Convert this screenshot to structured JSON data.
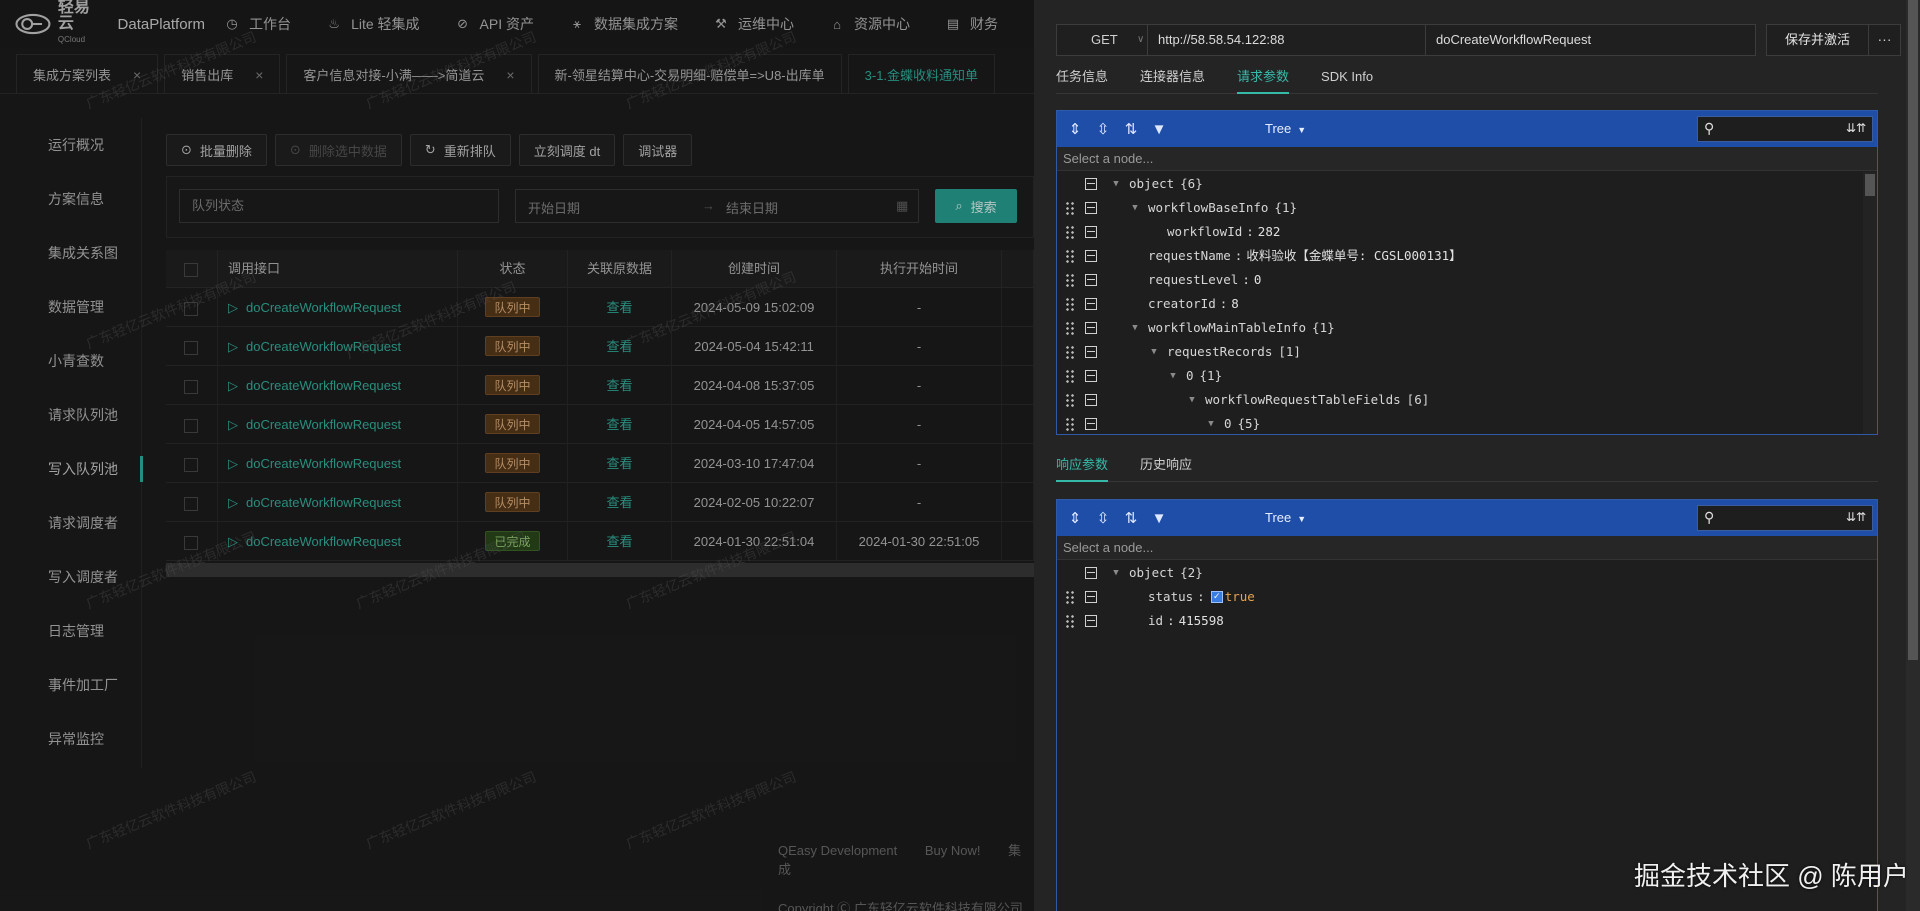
{
  "app": {
    "logo_text": "轻易云",
    "logo_sub": "QCloud",
    "brand": "DataPlatform",
    "nav": [
      {
        "label": "工作台",
        "icon": "clock-icon"
      },
      {
        "label": "Lite 轻集成",
        "icon": "bell-icon"
      },
      {
        "label": "API 资产",
        "icon": "compass-icon"
      },
      {
        "label": "数据集成方案",
        "icon": "network-icon"
      },
      {
        "label": "运维中心",
        "icon": "tools-icon"
      },
      {
        "label": "资源中心",
        "icon": "cluster-icon"
      },
      {
        "label": "财务",
        "icon": "ledger-icon"
      }
    ]
  },
  "tabs": [
    {
      "label": "集成方案列表"
    },
    {
      "label": "销售出库"
    },
    {
      "label": "客户信息对接-小满——>简道云"
    },
    {
      "label": "新-领星结算中心-交易明细-赔偿单=>U8-出库单"
    },
    {
      "label": "3-1.金蝶收料通知单",
      "active": true
    }
  ],
  "sidemenu": [
    "运行概况",
    "方案信息",
    "集成关系图",
    "数据管理",
    "小青查数",
    "请求队列池",
    "写入队列池",
    "请求调度者",
    "写入调度者",
    "日志管理",
    "事件加工厂",
    "异常监控"
  ],
  "sidemenu_active": "写入队列池",
  "toolbar": {
    "batch_delete": "批量删除",
    "delete_selected": "删除选中数据",
    "requeue": "重新排队",
    "schedule_now": "立刻调度 dt",
    "debugger": "调试器"
  },
  "filter": {
    "queue_status_placeholder": "队列状态",
    "start_date": "开始日期",
    "end_date": "结束日期",
    "search": "搜索"
  },
  "table": {
    "headers": [
      "调用接口",
      "状态",
      "关联原数据",
      "创建时间",
      "执行开始时间"
    ],
    "rows": [
      {
        "api": "doCreateWorkflowRequest",
        "status": "队列中",
        "status_type": "queue",
        "view": "查看",
        "created": "2024-05-09 15:02:09",
        "started": "-"
      },
      {
        "api": "doCreateWorkflowRequest",
        "status": "队列中",
        "status_type": "queue",
        "view": "查看",
        "created": "2024-05-04 15:42:11",
        "started": "-"
      },
      {
        "api": "doCreateWorkflowRequest",
        "status": "队列中",
        "status_type": "queue",
        "view": "查看",
        "created": "2024-04-08 15:37:05",
        "started": "-"
      },
      {
        "api": "doCreateWorkflowRequest",
        "status": "队列中",
        "status_type": "queue",
        "view": "查看",
        "created": "2024-04-05 14:57:05",
        "started": "-"
      },
      {
        "api": "doCreateWorkflowRequest",
        "status": "队列中",
        "status_type": "queue",
        "view": "查看",
        "created": "2024-03-10 17:47:04",
        "started": "-"
      },
      {
        "api": "doCreateWorkflowRequest",
        "status": "队列中",
        "status_type": "queue",
        "view": "查看",
        "created": "2024-02-05 10:22:07",
        "started": "-"
      },
      {
        "api": "doCreateWorkflowRequest",
        "status": "已完成",
        "status_type": "done",
        "view": "查看",
        "created": "2024-01-30 22:51:04",
        "started": "2024-01-30 22:51:05"
      }
    ]
  },
  "footer": {
    "links": [
      "QEasy Development",
      "Buy Now!",
      "集成"
    ],
    "copyright": "Copyright Ⓒ 广东轻亿云软件科技有限公司"
  },
  "watermark": "广东轻亿云软件科技有限公司",
  "drawer": {
    "method": "GET",
    "url": "http://58.58.54.122:88",
    "api_name": "doCreateWorkflowRequest",
    "save_label": "保存并激活",
    "more_label": "···",
    "tabs": [
      {
        "label": "任务信息"
      },
      {
        "label": "连接器信息"
      },
      {
        "label": "请求参数",
        "active": true
      },
      {
        "label": "SDK Info"
      }
    ],
    "resp_tabs": [
      {
        "label": "响应参数",
        "active": true
      },
      {
        "label": "历史响应"
      }
    ],
    "editor_mode": "Tree",
    "node_placeholder": "Select a node...",
    "request_tree": [
      {
        "depth": 0,
        "drag": false,
        "expand": true,
        "key": "object",
        "meta": "{6}"
      },
      {
        "depth": 1,
        "drag": true,
        "expand": true,
        "key": "workflowBaseInfo",
        "meta": "{1}"
      },
      {
        "depth": 2,
        "drag": true,
        "expand": false,
        "key": "workflowId",
        "value": "282"
      },
      {
        "depth": 1,
        "drag": true,
        "expand": false,
        "key": "requestName",
        "value": "收料验收【金蝶单号: CGSL000131】"
      },
      {
        "depth": 1,
        "drag": true,
        "expand": false,
        "key": "requestLevel",
        "value": "0"
      },
      {
        "depth": 1,
        "drag": true,
        "expand": false,
        "key": "creatorId",
        "value": "8"
      },
      {
        "depth": 1,
        "drag": true,
        "expand": true,
        "key": "workflowMainTableInfo",
        "meta": "{1}"
      },
      {
        "depth": 2,
        "drag": true,
        "expand": true,
        "key": "requestRecords",
        "meta": "[1]"
      },
      {
        "depth": 3,
        "drag": true,
        "expand": true,
        "key": "0",
        "meta": "{1}"
      },
      {
        "depth": 4,
        "drag": true,
        "expand": true,
        "key": "workflowRequestTableFields",
        "meta": "[6]"
      },
      {
        "depth": 5,
        "drag": true,
        "expand": true,
        "key": "0",
        "meta": "{5}"
      }
    ],
    "response_tree": [
      {
        "depth": 0,
        "drag": false,
        "expand": true,
        "key": "object",
        "meta": "{2}"
      },
      {
        "depth": 1,
        "drag": true,
        "expand": false,
        "key": "status",
        "value": "true",
        "bool": true
      },
      {
        "depth": 1,
        "drag": true,
        "expand": false,
        "key": "id",
        "value": "415598"
      }
    ]
  },
  "overlay_caption": "掘金技术社区 @ 陈用户"
}
